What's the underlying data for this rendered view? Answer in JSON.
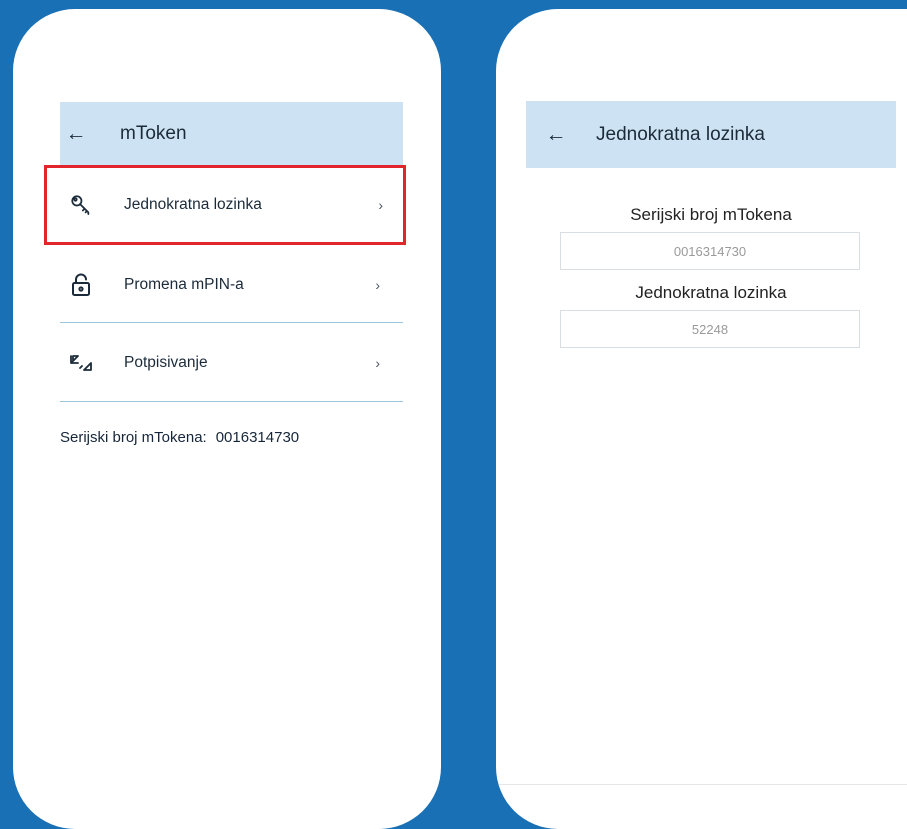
{
  "left_screen": {
    "title": "mToken",
    "back_icon": "arrow-left-icon",
    "items": [
      {
        "label": "Jednokratna lozinka",
        "icon": "key-icon",
        "chevron": "›"
      },
      {
        "label": "Promena mPIN-a",
        "icon": "unlock-icon",
        "chevron": "›"
      },
      {
        "label": "Potpisivanje",
        "icon": "sign-arrows-icon",
        "chevron": "›"
      }
    ],
    "serial_label": "Serijski broj mTokena:",
    "serial_value": "0016314730"
  },
  "right_screen": {
    "title": "Jednokratna lozinka",
    "back_icon": "arrow-left-icon",
    "serial_label": "Serijski broj mTokena",
    "serial_value": "0016314730",
    "otp_label": "Jednokratna lozinka",
    "otp_value": "52248"
  },
  "colors": {
    "background": "#1a70b5",
    "appbar": "#cde3f3",
    "highlight": "#e2242b",
    "divider": "#9cc6dd"
  },
  "back_glyph": "←"
}
